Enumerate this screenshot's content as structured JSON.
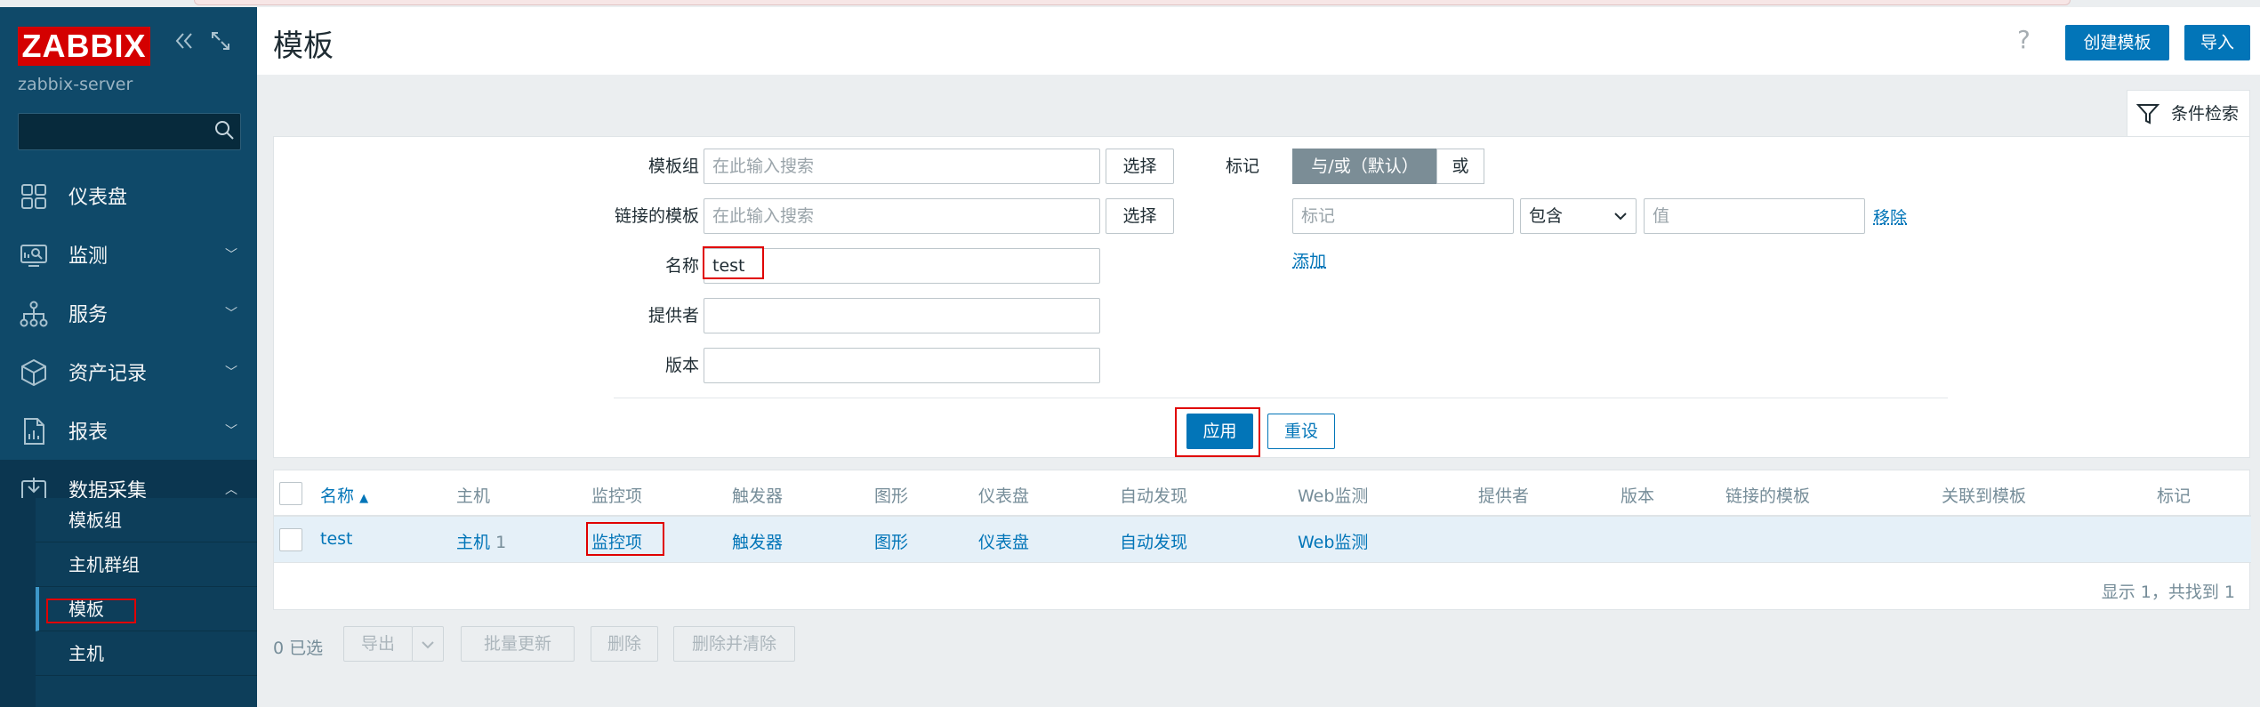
{
  "app": {
    "logo_text": "ZABBIX",
    "server_name": "zabbix-server",
    "brand_color": "#d40000",
    "accent_color": "#0275b8"
  },
  "sidebar": {
    "items": [
      {
        "label": "仪表盘",
        "icon": "dashboard-icon"
      },
      {
        "label": "监测",
        "icon": "monitoring-icon"
      },
      {
        "label": "服务",
        "icon": "services-icon"
      },
      {
        "label": "资产记录",
        "icon": "inventory-icon"
      },
      {
        "label": "报表",
        "icon": "reports-icon"
      },
      {
        "label": "数据采集",
        "icon": "data-collection-icon",
        "expanded": true
      }
    ],
    "sub_items": [
      "模板组",
      "主机群组",
      "模板",
      "主机"
    ]
  },
  "header": {
    "title": "模板",
    "help": "?",
    "create_button": "创建模板",
    "import_button": "导入"
  },
  "filter": {
    "tab_label": "条件检索",
    "template_group": {
      "label": "模板组",
      "placeholder": "在此输入搜索",
      "select": "选择"
    },
    "linked_templates": {
      "label": "链接的模板",
      "placeholder": "在此输入搜索",
      "select": "选择"
    },
    "name": {
      "label": "名称",
      "value": "test"
    },
    "vendor": {
      "label": "提供者",
      "value": ""
    },
    "version": {
      "label": "版本",
      "value": ""
    },
    "tags": {
      "label": "标记",
      "and_or": "与/或（默认）",
      "or": "或",
      "tag_placeholder": "标记",
      "operator": "包含",
      "value_placeholder": "值",
      "remove": "移除",
      "add": "添加"
    },
    "apply": "应用",
    "reset": "重设"
  },
  "table": {
    "columns": [
      "名称",
      "主机",
      "监控项",
      "触发器",
      "图形",
      "仪表盘",
      "自动发现",
      "Web监测",
      "提供者",
      "版本",
      "链接的模板",
      "关联到模板",
      "标记"
    ],
    "sort_indicator": "▲",
    "rows": [
      {
        "name": "test",
        "hosts": "主机",
        "hosts_count": "1",
        "items": "监控项",
        "triggers": "触发器",
        "graphs": "图形",
        "dashboards": "仪表盘",
        "discovery": "自动发现",
        "web": "Web监测"
      }
    ],
    "footer": "显示 1，共找到 1"
  },
  "actions": {
    "selected": "0 已选",
    "export": "导出",
    "mass_update": "批量更新",
    "delete": "删除",
    "delete_clear": "删除并清除"
  }
}
